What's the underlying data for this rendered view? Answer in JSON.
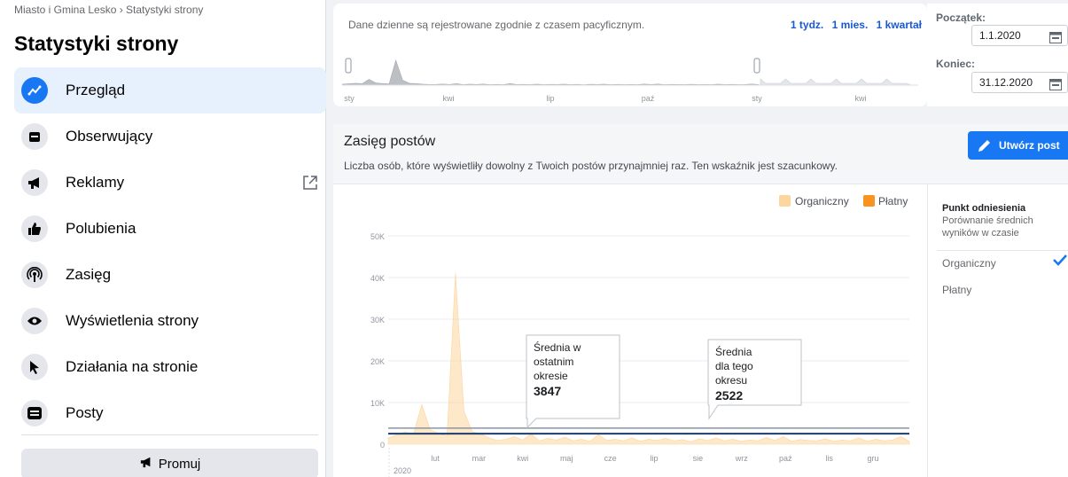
{
  "sidebar": {
    "breadcrumb": "Miasto i Gmina Lesko › Statystyki strony",
    "title": "Statystyki strony",
    "items": [
      {
        "label": "Przegląd",
        "icon": "trend-icon"
      },
      {
        "label": "Obserwujący",
        "icon": "inbox-icon"
      },
      {
        "label": "Reklamy",
        "icon": "megaphone-icon"
      },
      {
        "label": "Polubienia",
        "icon": "thumbs-up-icon"
      },
      {
        "label": "Zasięg",
        "icon": "broadcast-icon"
      },
      {
        "label": "Wyświetlenia strony",
        "icon": "eye-icon"
      },
      {
        "label": "Działania na stronie",
        "icon": "pointer-icon"
      },
      {
        "label": "Posty",
        "icon": "posts-icon"
      }
    ],
    "promo_label": "Promuj"
  },
  "range": {
    "note": "Dane dzienne są rejestrowane zgodnie z czasem pacyficznym.",
    "links": [
      "1 tydz.",
      "1 mies.",
      "1 kwartał"
    ],
    "mini_ticks": [
      "sty",
      "kwi",
      "lip",
      "paź",
      "sty",
      "kwi"
    ],
    "start_label": "Początek:",
    "start_value": "1.1.2020",
    "end_label": "Koniec:",
    "end_value": "31.12.2020"
  },
  "reach": {
    "title": "Zasięg postów",
    "description": "Liczba osób, które wyświetliły dowolny z Twoich postów przynajmniej raz. Ten wskaźnik jest szacunkowy.",
    "create_label": "Utwórz post",
    "benchmark_title": "Punkt odniesienia",
    "benchmark_sub": "Porównanie średnich wyników w czasie",
    "benchmark_options": [
      "Organiczny",
      "Płatny"
    ]
  },
  "colors": {
    "accent": "#1877f2",
    "organic": "#fcd59f",
    "paid": "#f7931e",
    "avg_line": "#1d3b6b"
  },
  "chart_data": {
    "type": "area",
    "title": "",
    "xlabel": "",
    "ylabel": "",
    "ylim": [
      0,
      50000
    ],
    "yticks": [
      "0",
      "10K",
      "20K",
      "30K",
      "40K",
      "50K"
    ],
    "x_tick_labels": [
      "lut",
      "mar",
      "kwi",
      "maj",
      "cze",
      "lip",
      "sie",
      "wrz",
      "paź",
      "lis",
      "gru"
    ],
    "year_label": "2020",
    "legend": [
      "Organiczny",
      "Płatny"
    ],
    "legend_position": "top-right",
    "series": [
      {
        "name": "Organiczny",
        "values": [
          1500,
          2200,
          3000,
          2400,
          9500,
          3500,
          2600,
          2000,
          41000,
          8000,
          3000,
          2500,
          1500,
          900,
          1200,
          1800,
          1000,
          2500,
          800,
          1400,
          1000,
          1700,
          800,
          1200,
          700,
          2300,
          900,
          1200,
          800,
          1500,
          700,
          1200,
          900,
          1400,
          800,
          1100,
          600,
          1300,
          900,
          1500,
          800,
          1200,
          700,
          1000,
          800,
          1600,
          900,
          1800,
          700,
          1100,
          900,
          800,
          1300,
          700,
          1000,
          800,
          1500,
          700,
          1200,
          800,
          1000,
          1800,
          700
        ]
      },
      {
        "name": "Płatny",
        "values": []
      }
    ],
    "annotations": [
      {
        "label": "Średnia w ostatnim okresie",
        "value": "3847"
      },
      {
        "label": "Średnia dla tego okresu",
        "value": "2522"
      }
    ],
    "avg_lines": [
      3847,
      2522
    ]
  }
}
